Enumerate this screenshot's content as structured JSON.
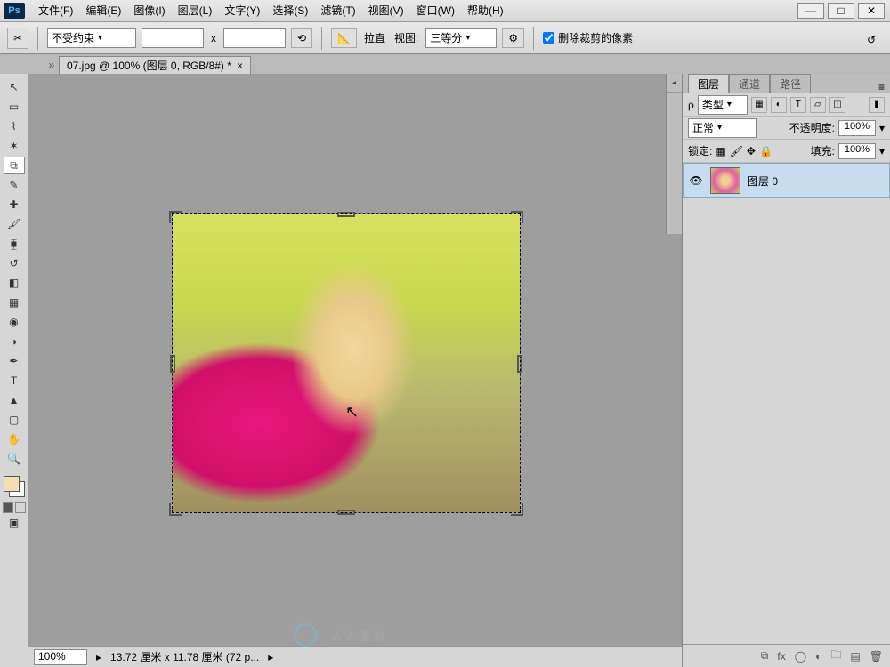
{
  "app": {
    "logo": "Ps"
  },
  "menu": {
    "file": "文件(F)",
    "edit": "编辑(E)",
    "image": "图像(I)",
    "layer": "图层(L)",
    "type": "文字(Y)",
    "select": "选择(S)",
    "filter": "滤镜(T)",
    "view": "视图(V)",
    "window": "窗口(W)",
    "help": "帮助(H)"
  },
  "window_controls": {
    "min": "—",
    "max": "□",
    "close": "✕"
  },
  "options": {
    "ratio_preset": "不受约束",
    "x_sep": "x",
    "straighten": "拉直",
    "view_label": "视图:",
    "view_preset": "三等分",
    "delete_cropped_label": "删除裁剪的像素",
    "delete_cropped_checked": true
  },
  "doc_tab": {
    "title": "07.jpg @ 100% (图层 0, RGB/8#) *",
    "close": "×"
  },
  "panels": {
    "tabs": {
      "layers": "图层",
      "channels": "通道",
      "paths": "路径"
    },
    "filter_label": "类型",
    "blend_mode": "正常",
    "opacity_label": "不透明度:",
    "opacity_value": "100%",
    "lock_label": "锁定:",
    "fill_label": "填充:",
    "fill_value": "100%",
    "layer0_name": "图层 0"
  },
  "status": {
    "zoom": "100%",
    "doc_size": "13.72 厘米 x 11.78 厘米 (72 p..."
  },
  "watermark": "人人素材"
}
